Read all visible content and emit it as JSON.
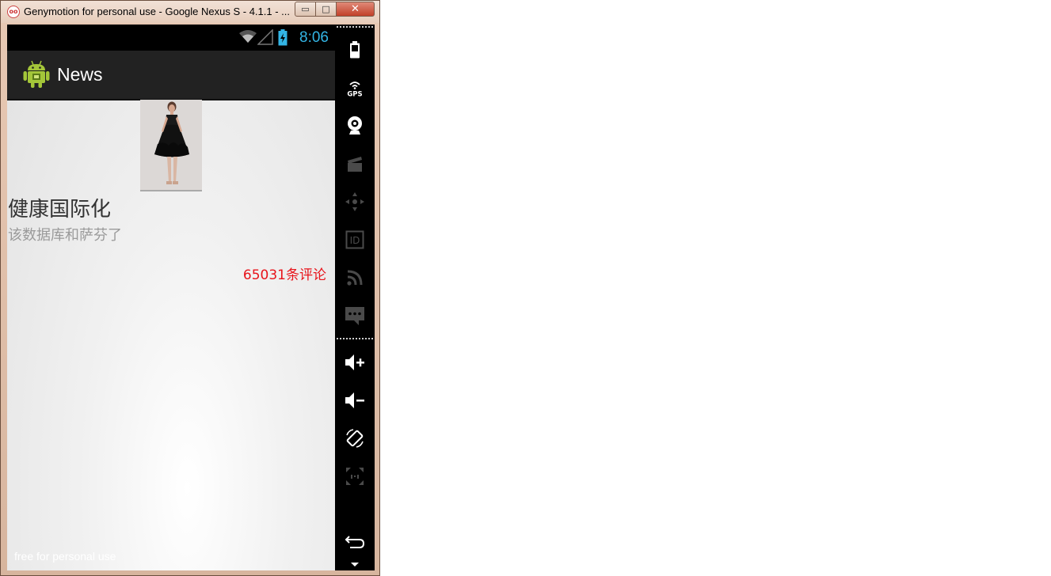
{
  "window": {
    "title": "Genymotion for personal use - Google Nexus S - 4.1.1 - ...",
    "app_icon_text": "oo",
    "minimize_label": "▭",
    "maximize_label": "□",
    "close_label": "✕"
  },
  "statusbar": {
    "time": "8:06"
  },
  "actionbar": {
    "title": "News"
  },
  "news_item": {
    "image_desc": "woman in black dress",
    "title": "健康国际化",
    "description": "该数据库和萨芬了",
    "comments": "65031条评论"
  },
  "watermark": "free for personal use",
  "sidebar": {
    "icons": [
      "battery-icon",
      "gps-icon",
      "webcam-icon",
      "video-icon",
      "dpad-icon",
      "id-icon",
      "rss-icon",
      "sms-icon",
      "volume-up-icon",
      "volume-down-icon",
      "rotate-icon",
      "scale-icon",
      "back-icon"
    ],
    "gps_label": "GPS",
    "id_label": "ID"
  },
  "colors": {
    "status_time": "#33b5e5",
    "actionbar_bg": "#222222",
    "comments_red": "#e8131a",
    "title_gray": "#333333",
    "desc_gray": "#9a9a9a"
  }
}
